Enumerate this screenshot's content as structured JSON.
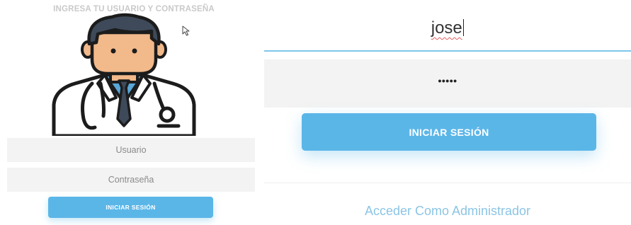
{
  "left": {
    "title": "INGRESA TU USUARIO Y CONTRASEÑA",
    "avatar": {
      "icon": "doctor-avatar-icon"
    },
    "username_placeholder": "Usuario",
    "password_placeholder": "Contraseña",
    "login_label": "INICIAR SESIÓN"
  },
  "right": {
    "username_value": "jose",
    "password_masked": "•••••",
    "login_label": "INICIAR SESIÓN",
    "admin_link": "Acceder Como Administrador"
  },
  "colors": {
    "accent": "#5bb6e8",
    "field_bg": "#f3f3f3",
    "focus_underline": "#7ec8ea",
    "link": "#8bc5e4"
  }
}
